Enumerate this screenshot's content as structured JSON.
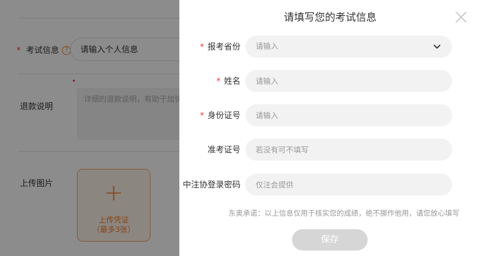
{
  "background": {
    "exam_info": {
      "label": "考试信息",
      "help_icon_text": "?",
      "input_value": "请输入个人信息"
    },
    "refund": {
      "label": "退款说明",
      "placeholder": "详细的退款说明，有助于加快"
    },
    "upload": {
      "label": "上传图片",
      "plus": "+",
      "line1": "上传凭证",
      "line2": "（最多3张）"
    }
  },
  "modal": {
    "title": "请填写您的考试信息",
    "fields": [
      {
        "label": "报考省份",
        "required": "*",
        "placeholder": "请输入",
        "type": "select"
      },
      {
        "label": "姓名",
        "required": "*",
        "placeholder": "请输入",
        "type": "text"
      },
      {
        "label": "身份证号",
        "required": "*",
        "placeholder": "请输入",
        "type": "text"
      },
      {
        "label": "准考证号",
        "required": "",
        "placeholder": "若没有可不填写",
        "type": "text"
      },
      {
        "label": "中注协登录密码",
        "required": "",
        "placeholder": "仅注会提供",
        "type": "text"
      }
    ],
    "promise": "东奥承诺：以上信息仅用于核实您的成绩，绝不挪作他用，请您放心填写",
    "save_label": "保存"
  },
  "colors": {
    "required": "#e4393c",
    "accent_orange": "#f07c2d",
    "input_bg": "#f2f2f2",
    "save_disabled": "#d6d6d6",
    "overlay": "rgba(0,0,0,0.45)"
  }
}
